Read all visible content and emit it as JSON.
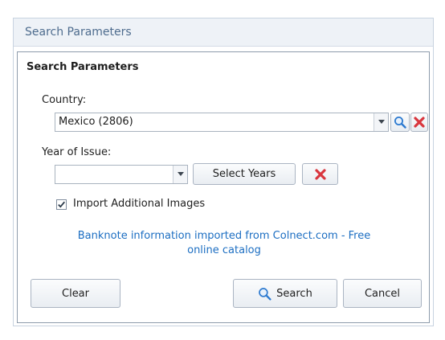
{
  "panel": {
    "header_title": "Search Parameters"
  },
  "group": {
    "title": "Search Parameters"
  },
  "country": {
    "label": "Country:",
    "value": "Mexico (2806)"
  },
  "year": {
    "label": "Year of Issue:",
    "value": "",
    "select_years_label": "Select Years"
  },
  "import_images": {
    "label": "Import Additional Images",
    "checked": true
  },
  "credit": {
    "line1": "Banknote information imported from Colnect.com - Free",
    "line2": "online catalog"
  },
  "buttons": {
    "clear": "Clear",
    "search": "Search",
    "cancel": "Cancel"
  },
  "icons": {
    "search": "search-icon",
    "delete": "delete-x-icon",
    "dropdown": "chevron-down-icon",
    "checkbox": "checkmark-icon"
  },
  "colors": {
    "accent_blue": "#1c6ec2",
    "delete_red": "#d9363e",
    "header_text": "#4e6c8e"
  }
}
